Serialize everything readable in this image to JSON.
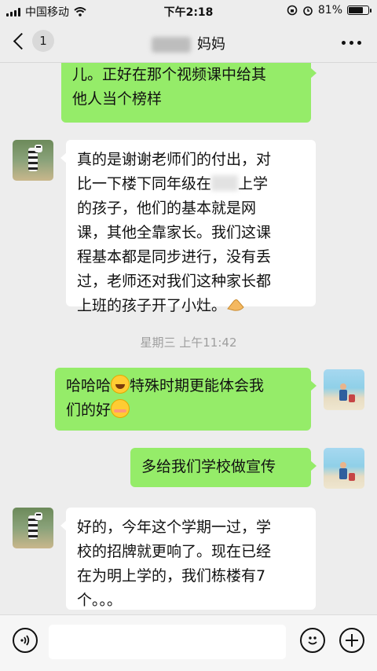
{
  "status_bar": {
    "carrier": "中国移动",
    "time": "下午2:18",
    "battery_percent": "81%",
    "battery_level": 0.81
  },
  "nav": {
    "back_badge": "1",
    "title_visible": "妈妈",
    "more_icon": "more-dots-icon"
  },
  "messages": [
    {
      "side": "right",
      "lines": [
        "儿。正好在那个视频课中给其",
        "他人当个榜样"
      ]
    },
    {
      "side": "left",
      "avatar": "zebra-avatar",
      "lines": [
        "真的是谢谢老师们的付出，对",
        "比一下楼下同年级在",
        "上学",
        "的孩子，他们的基本就是网",
        "课，其他全靠家长。我们这课",
        "程基本都是同步进行，没有丢",
        "过，老师还对我们这种家长都",
        "上班的孩子开了小灶。"
      ]
    },
    {
      "side": "right",
      "avatar": "beach-avatar",
      "lines": [
        "哈哈哈",
        "特殊时期更能体会我",
        "们的好"
      ]
    },
    {
      "side": "right",
      "avatar": "beach-avatar",
      "lines": [
        "多给我们学校做宣传"
      ]
    },
    {
      "side": "left",
      "avatar": "zebra-avatar",
      "lines": [
        "好的，今年这个学期一过，学",
        "校的招牌就更响了。现在已经",
        "在为明上学的，我们栋楼有7",
        "个。。。"
      ]
    }
  ],
  "timestamp": "星期三 上午11:42",
  "input_bar": {
    "voice_icon": "voice-icon",
    "emoji_icon": "emoji-icon",
    "plus_icon": "plus-icon",
    "placeholder": ""
  },
  "colors": {
    "background": "#ededed",
    "bubble_sent": "#95ec69",
    "bubble_received": "#ffffff",
    "timestamp": "#9e9e9e"
  }
}
